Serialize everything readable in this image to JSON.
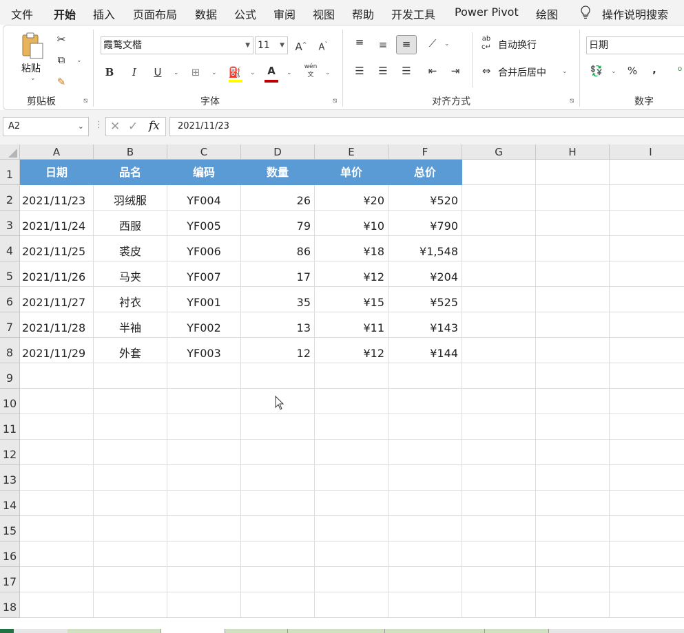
{
  "menu": [
    "文件",
    "开始",
    "插入",
    "页面布局",
    "数据",
    "公式",
    "审阅",
    "视图",
    "帮助",
    "开发工具",
    "Power Pivot",
    "绘图"
  ],
  "active_menu": "开始",
  "tell_me": "操作说明搜索",
  "ribbon": {
    "clipboard_group": "剪贴板",
    "paste_label": "粘贴",
    "font_group": "字体",
    "font_name": "霞鹜文楷",
    "font_size": "11",
    "align_group": "对齐方式",
    "wrap_text": "自动换行",
    "merge_center": "合并后居中",
    "number_group": "数字",
    "number_format": "日期",
    "bold": "B",
    "italic": "I",
    "underline": "U",
    "font_color_letter": "A",
    "phonetic": "wén",
    "percent": "%",
    "comma": ",",
    "grow_font": "A",
    "shrink_font": "A"
  },
  "formula_bar": {
    "name_box": "A2",
    "fx": "fx",
    "formula": "2021/11/23"
  },
  "columns": [
    "A",
    "B",
    "C",
    "D",
    "E",
    "F",
    "G",
    "H",
    "I"
  ],
  "rows": [
    "1",
    "2",
    "3",
    "4",
    "5",
    "6",
    "7",
    "8",
    "9",
    "10",
    "11",
    "12",
    "13",
    "14",
    "15",
    "16",
    "17",
    "18"
  ],
  "table_header": [
    "日期",
    "品名",
    "编码",
    "数量",
    "单价",
    "总价"
  ],
  "table_rows": [
    [
      "2021/11/23",
      "羽绒服",
      "YF004",
      "26",
      "¥20",
      "¥520"
    ],
    [
      "2021/11/24",
      "西服",
      "YF005",
      "79",
      "¥10",
      "¥790"
    ],
    [
      "2021/11/25",
      "裘皮",
      "YF006",
      "86",
      "¥18",
      "¥1,548"
    ],
    [
      "2021/11/26",
      "马夹",
      "YF007",
      "17",
      "¥12",
      "¥204"
    ],
    [
      "2021/11/27",
      "衬衣",
      "YF001",
      "35",
      "¥15",
      "¥525"
    ],
    [
      "2021/11/28",
      "半袖",
      "YF002",
      "13",
      "¥11",
      "¥143"
    ],
    [
      "2021/11/29",
      "外套",
      "YF003",
      "12",
      "¥12",
      "¥144"
    ]
  ],
  "colors": {
    "header_fill": "#5b9bd5",
    "sheet_tab": "#cfe0c3",
    "font_color_bar": "#c00000"
  }
}
